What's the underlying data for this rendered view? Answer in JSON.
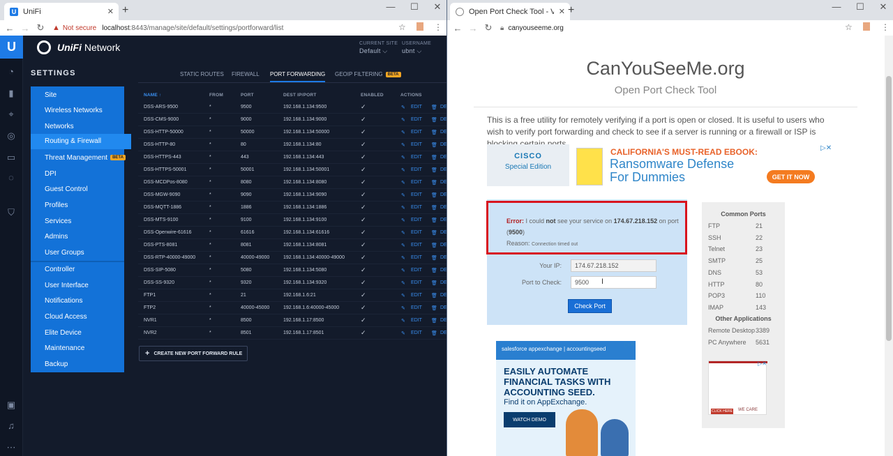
{
  "left_browser": {
    "tab_title": "UniFi",
    "tab_favicon": "U",
    "not_secure_label": "Not secure",
    "url_host": "localhost",
    "url_path": ":8443/manage/site/default/settings/portforward/list"
  },
  "right_browser": {
    "tab_title": "Open Port Check Tool - Verify P",
    "url": "canyouseeme.org"
  },
  "unifi": {
    "brand_italic": "UniFi",
    "brand_rest": " Network",
    "current_site_label": "CURRENT SITE",
    "current_site_value": "Default ⌵",
    "username_label": "USERNAME",
    "username_value": "ubnt ⌵",
    "settings_title": "SETTINGS",
    "menu": [
      "Site",
      "Wireless Networks",
      "Networks",
      "Routing & Firewall",
      "Threat Management",
      "DPI",
      "Guest Control",
      "Profiles",
      "Services",
      "Admins",
      "User Groups",
      "Controller",
      "User Interface",
      "Notifications",
      "Cloud Access",
      "Elite Device",
      "Maintenance",
      "Backup"
    ],
    "beta_badge": "BETA",
    "subtabs": [
      "STATIC ROUTES",
      "FIREWALL",
      "PORT FORWARDING",
      "GEOIP FILTERING"
    ],
    "columns": [
      "NAME ↑",
      "FROM",
      "PORT",
      "DEST IP/PORT",
      "ENABLED",
      "ACTIONS"
    ],
    "edit_label": "EDIT",
    "delete_label": "DE",
    "rows": [
      [
        "DSS-ARS-9500",
        "*",
        "9500",
        "192.168.1.134:9500"
      ],
      [
        "DSS-CMS-9000",
        "*",
        "9000",
        "192.168.1.134:9000"
      ],
      [
        "DSS-HTTP-50000",
        "*",
        "50000",
        "192.168.1.134:50000"
      ],
      [
        "DSS-HTTP-80",
        "*",
        "80",
        "192.168.1.134:80"
      ],
      [
        "DSS-HTTPS-443",
        "*",
        "443",
        "192.168.1.134:443"
      ],
      [
        "DSS-HTTPS-50001",
        "*",
        "50001",
        "192.168.1.134:50001"
      ],
      [
        "DSS-MCDPos-8080",
        "*",
        "8080",
        "192.168.1.134:8080"
      ],
      [
        "DSS-MGW-9090",
        "*",
        "9090",
        "192.168.1.134:9090"
      ],
      [
        "DSS-MQTT-1886",
        "*",
        "1886",
        "192.168.1.134:1886"
      ],
      [
        "DSS-MTS-9100",
        "*",
        "9100",
        "192.168.1.134:9100"
      ],
      [
        "DSS-Openwire-61616",
        "*",
        "61616",
        "192.168.1.134:61616"
      ],
      [
        "DSS-PTS-8081",
        "*",
        "8081",
        "192.168.1.134:8081"
      ],
      [
        "DSS-RTP-40000-49000",
        "*",
        "40000-49000",
        "192.168.1.134:40000-49000"
      ],
      [
        "DSS-SIP-5080",
        "*",
        "5080",
        "192.168.1.134:5080"
      ],
      [
        "DSS-SS-9320",
        "*",
        "9320",
        "192.168.1.134:9320"
      ],
      [
        "FTP1",
        "*",
        "21",
        "192.168.1.6:21"
      ],
      [
        "FTP2",
        "*",
        "40000-45000",
        "192.168.1.6:40000-45000"
      ],
      [
        "NVR1",
        "*",
        "8500",
        "192.168.1.17:8500"
      ],
      [
        "NVR2",
        "*",
        "8501",
        "192.168.1.17:8501"
      ]
    ],
    "create_button": "CREATE NEW PORT FORWARD RULE"
  },
  "cysm": {
    "title": "CanYouSeeMe.org",
    "subtitle": "Open Port Check Tool",
    "intro": "This is a free utility for remotely verifying if a port is open or closed. It is useful to users who wish to verify port forwarding and check to see if a server is running or a firewall or ISP is blocking certain ports.",
    "ad1": {
      "brand": "CISCO",
      "edition": "Special Edition",
      "headline": "CALIFORNIA'S MUST-READ EBOOK:",
      "title_line1": "Ransomware Defense",
      "title_line2": "For Dummies",
      "cta": "GET IT NOW"
    },
    "error": {
      "label": "Error:",
      "t1": " I could ",
      "not": "not",
      "t2": " see your service on ",
      "ip": "174.67.218.152",
      "t3": " on port (",
      "port": "9500",
      "t4": ")",
      "reason_label": "Reason:",
      "reason": "Connection timed out"
    },
    "your_ip_label": "Your IP:",
    "your_ip_value": "174.67.218.152",
    "port_label": "Port to Check:",
    "port_value": "9500",
    "check_button": "Check Port",
    "common_ports_title": "Common Ports",
    "common_ports": [
      [
        "FTP",
        "21"
      ],
      [
        "SSH",
        "22"
      ],
      [
        "Telnet",
        "23"
      ],
      [
        "SMTP",
        "25"
      ],
      [
        "DNS",
        "53"
      ],
      [
        "HTTP",
        "80"
      ],
      [
        "POP3",
        "110"
      ],
      [
        "IMAP",
        "143"
      ]
    ],
    "other_apps_title": "Other Applications",
    "other_apps": [
      [
        "Remote Desktop",
        "3389"
      ],
      [
        "PC Anywhere",
        "5631"
      ]
    ],
    "ad3": {
      "click": "CLICK HERE",
      "care": "WE CARE"
    },
    "ad2": {
      "top": "salesforce appexchange  |  accountingseed",
      "line1": "EASILY AUTOMATE",
      "line2": "FINANCIAL TASKS WITH",
      "line3": "ACCOUNTING SEED.",
      "find": "Find it on AppExchange.",
      "cta": "WATCH DEMO"
    }
  },
  "colors": {
    "unifi_blue": "#1372d8",
    "error_red": "#d8141e",
    "cysm_blue": "#cde3f7"
  }
}
